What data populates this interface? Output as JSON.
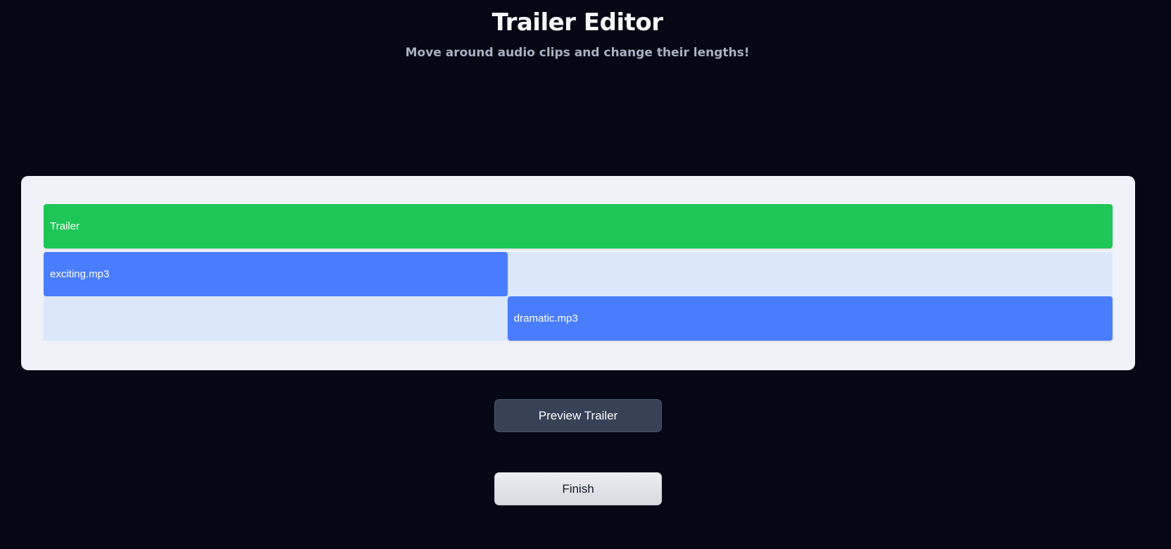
{
  "header": {
    "title": "Trailer Editor",
    "subtitle": "Move around audio clips and change their lengths!"
  },
  "timeline": {
    "tracks": [
      {
        "name": "Trailer",
        "clips": [
          {
            "label": "Trailer",
            "start_fraction": 0.0,
            "length_fraction": 1.0,
            "color": "#1dc656"
          }
        ]
      },
      {
        "name": "exciting.mp3",
        "clips": [
          {
            "label": "exciting.mp3",
            "start_fraction": 0.0,
            "length_fraction": 0.434,
            "color": "#4a7dfd"
          }
        ]
      },
      {
        "name": "dramatic.mp3",
        "clips": [
          {
            "label": "dramatic.mp3",
            "start_fraction": 0.434,
            "length_fraction": 0.566,
            "color": "#4a7dfd"
          }
        ]
      }
    ],
    "empty_track_color": "#dbe8fb"
  },
  "actions": {
    "preview_label": "Preview Trailer",
    "finish_label": "Finish"
  },
  "colors": {
    "background": "#050814",
    "panel": "#eff3f9",
    "trailer_clip": "#1dc656",
    "audio_clip": "#4a7dfd"
  }
}
